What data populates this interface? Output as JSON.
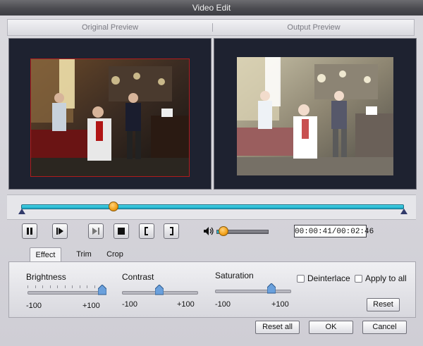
{
  "window": {
    "title": "Video Edit"
  },
  "preview": {
    "original_label": "Original Preview",
    "output_label": "Output Preview"
  },
  "playback": {
    "progress": 0.24,
    "volume": 0.13,
    "time_display": "00:00:41/00:02:46"
  },
  "tabs": [
    {
      "label": "Effect",
      "active": true
    },
    {
      "label": "Trim",
      "active": false
    },
    {
      "label": "Crop",
      "active": false
    }
  ],
  "effect": {
    "brightness": {
      "label": "Brightness",
      "min": "-100",
      "max": "+100",
      "value": 100
    },
    "contrast": {
      "label": "Contrast",
      "min": "-100",
      "max": "+100",
      "value": 0
    },
    "saturation": {
      "label": "Saturation",
      "min": "-100",
      "max": "+100",
      "value": 50
    },
    "deinterlace": {
      "label": "Deinterlace",
      "checked": false
    },
    "apply_to_all": {
      "label": "Apply to all",
      "checked": false
    },
    "reset_label": "Reset"
  },
  "footer": {
    "reset_all_label": "Reset all",
    "ok_label": "OK",
    "cancel_label": "Cancel"
  },
  "colors": {
    "accent": "#22b3cc",
    "knob": "#f1a019",
    "preview_bg": "#1e2230",
    "original_border": "#b11c1c"
  }
}
